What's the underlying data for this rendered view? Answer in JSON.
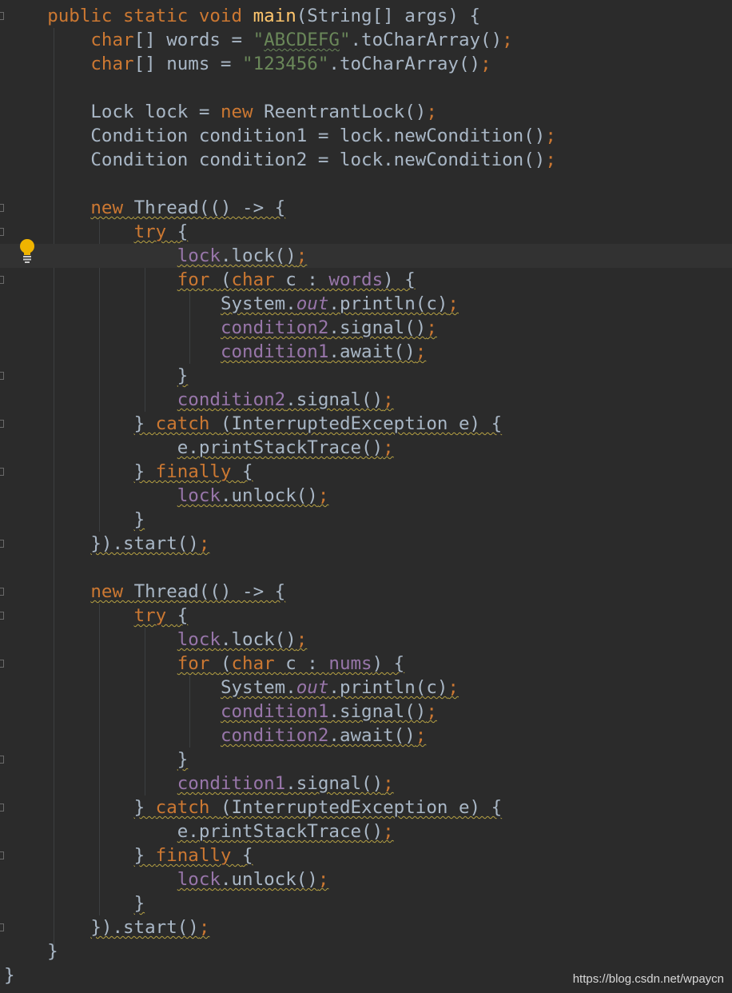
{
  "editor": {
    "colors": {
      "background": "#2b2b2b",
      "current_line": "#323232",
      "keyword": "#cc7832",
      "method_decl": "#ffc66d",
      "string": "#6a8759",
      "field": "#9876aa",
      "plain": "#a9b7c6",
      "warning_underline": "#b7a243"
    },
    "current_line_index": 10,
    "lines": [
      [
        {
          "t": "    "
        },
        {
          "t": "public static void ",
          "c": "kw"
        },
        {
          "t": "main",
          "c": "fn"
        },
        {
          "t": "(String[] args) {"
        }
      ],
      [
        {
          "t": "        "
        },
        {
          "t": "char",
          "c": "kw"
        },
        {
          "t": "[] words = "
        },
        {
          "t": "\"",
          "c": "str"
        },
        {
          "t": "ABCDEFG",
          "c": "str",
          "u": "typo"
        },
        {
          "t": "\"",
          "c": "str"
        },
        {
          "t": ".toCharArray()"
        },
        {
          "t": ";",
          "c": "kw"
        }
      ],
      [
        {
          "t": "        "
        },
        {
          "t": "char",
          "c": "kw"
        },
        {
          "t": "[] nums = "
        },
        {
          "t": "\"123456\"",
          "c": "str"
        },
        {
          "t": ".toCharArray()"
        },
        {
          "t": ";",
          "c": "kw"
        }
      ],
      [
        {
          "t": ""
        }
      ],
      [
        {
          "t": "        Lock lock = "
        },
        {
          "t": "new ",
          "c": "kw"
        },
        {
          "t": "ReentrantLock()"
        },
        {
          "t": ";",
          "c": "kw"
        }
      ],
      [
        {
          "t": "        Condition condition1 = lock.newCondition()"
        },
        {
          "t": ";",
          "c": "kw"
        }
      ],
      [
        {
          "t": "        Condition condition2 = lock.newCondition()"
        },
        {
          "t": ";",
          "c": "kw"
        }
      ],
      [
        {
          "t": ""
        }
      ],
      [
        {
          "t": "        "
        },
        {
          "t": "new ",
          "c": "kw",
          "u": "warn"
        },
        {
          "t": "Thread(() -> {",
          "u": "warn"
        }
      ],
      [
        {
          "t": "            "
        },
        {
          "t": "try ",
          "c": "kw",
          "u": "warn"
        },
        {
          "t": "{",
          "u": "warn"
        }
      ],
      [
        {
          "t": "                "
        },
        {
          "t": "lock",
          "c": "fld",
          "u": "warn"
        },
        {
          "t": ".lock()",
          "u": "warn"
        },
        {
          "t": ";",
          "c": "kw",
          "u": "warn"
        }
      ],
      [
        {
          "t": "                "
        },
        {
          "t": "for ",
          "c": "kw",
          "u": "warn"
        },
        {
          "t": "(",
          "u": "warn"
        },
        {
          "t": "char ",
          "c": "kw",
          "u": "warn"
        },
        {
          "t": "c : ",
          "u": "warn"
        },
        {
          "t": "words",
          "c": "fld",
          "u": "warn"
        },
        {
          "t": ") {",
          "u": "warn"
        }
      ],
      [
        {
          "t": "                    "
        },
        {
          "t": "System.",
          "u": "warn"
        },
        {
          "t": "out",
          "c": "fld-it",
          "u": "warn"
        },
        {
          "t": ".println(c)",
          "u": "warn"
        },
        {
          "t": ";",
          "c": "kw",
          "u": "warn"
        }
      ],
      [
        {
          "t": "                    "
        },
        {
          "t": "condition2",
          "c": "fld",
          "u": "warn"
        },
        {
          "t": ".signal()",
          "u": "warn"
        },
        {
          "t": ";",
          "c": "kw",
          "u": "warn"
        }
      ],
      [
        {
          "t": "                    "
        },
        {
          "t": "condition1",
          "c": "fld",
          "u": "warn"
        },
        {
          "t": ".await()",
          "u": "warn"
        },
        {
          "t": ";",
          "c": "kw",
          "u": "warn"
        }
      ],
      [
        {
          "t": "                "
        },
        {
          "t": "}",
          "u": "warn"
        }
      ],
      [
        {
          "t": "                "
        },
        {
          "t": "condition2",
          "c": "fld",
          "u": "warn"
        },
        {
          "t": ".signal()",
          "u": "warn"
        },
        {
          "t": ";",
          "c": "kw",
          "u": "warn"
        }
      ],
      [
        {
          "t": "            "
        },
        {
          "t": "} ",
          "u": "warn"
        },
        {
          "t": "catch ",
          "c": "kw",
          "u": "warn"
        },
        {
          "t": "(InterruptedException e) {",
          "u": "warn"
        }
      ],
      [
        {
          "t": "                "
        },
        {
          "t": "e.printStackTrace()",
          "u": "warn"
        },
        {
          "t": ";",
          "c": "kw",
          "u": "warn"
        }
      ],
      [
        {
          "t": "            "
        },
        {
          "t": "} ",
          "u": "warn"
        },
        {
          "t": "finally ",
          "c": "kw",
          "u": "warn"
        },
        {
          "t": "{",
          "u": "warn"
        }
      ],
      [
        {
          "t": "                "
        },
        {
          "t": "lock",
          "c": "fld",
          "u": "warn"
        },
        {
          "t": ".unlock()",
          "u": "warn"
        },
        {
          "t": ";",
          "c": "kw",
          "u": "warn"
        }
      ],
      [
        {
          "t": "            "
        },
        {
          "t": "}",
          "u": "warn"
        }
      ],
      [
        {
          "t": "        "
        },
        {
          "t": "}).start()",
          "u": "warn"
        },
        {
          "t": ";",
          "c": "kw",
          "u": "warn"
        }
      ],
      [
        {
          "t": ""
        }
      ],
      [
        {
          "t": "        "
        },
        {
          "t": "new ",
          "c": "kw",
          "u": "warn"
        },
        {
          "t": "Thread(() -> {",
          "u": "warn"
        }
      ],
      [
        {
          "t": "            "
        },
        {
          "t": "try ",
          "c": "kw",
          "u": "warn"
        },
        {
          "t": "{",
          "u": "warn"
        }
      ],
      [
        {
          "t": "                "
        },
        {
          "t": "lock",
          "c": "fld",
          "u": "warn"
        },
        {
          "t": ".lock()",
          "u": "warn"
        },
        {
          "t": ";",
          "c": "kw",
          "u": "warn"
        }
      ],
      [
        {
          "t": "                "
        },
        {
          "t": "for ",
          "c": "kw",
          "u": "warn"
        },
        {
          "t": "(",
          "u": "warn"
        },
        {
          "t": "char ",
          "c": "kw",
          "u": "warn"
        },
        {
          "t": "c : ",
          "u": "warn"
        },
        {
          "t": "nums",
          "c": "fld",
          "u": "warn"
        },
        {
          "t": ") {",
          "u": "warn"
        }
      ],
      [
        {
          "t": "                    "
        },
        {
          "t": "System.",
          "u": "warn"
        },
        {
          "t": "out",
          "c": "fld-it",
          "u": "warn"
        },
        {
          "t": ".println(c)",
          "u": "warn"
        },
        {
          "t": ";",
          "c": "kw",
          "u": "warn"
        }
      ],
      [
        {
          "t": "                    "
        },
        {
          "t": "condition1",
          "c": "fld",
          "u": "warn"
        },
        {
          "t": ".signal()",
          "u": "warn"
        },
        {
          "t": ";",
          "c": "kw",
          "u": "warn"
        }
      ],
      [
        {
          "t": "                    "
        },
        {
          "t": "condition2",
          "c": "fld",
          "u": "warn"
        },
        {
          "t": ".await()",
          "u": "warn"
        },
        {
          "t": ";",
          "c": "kw",
          "u": "warn"
        }
      ],
      [
        {
          "t": "                "
        },
        {
          "t": "}",
          "u": "warn"
        }
      ],
      [
        {
          "t": "                "
        },
        {
          "t": "condition1",
          "c": "fld",
          "u": "warn"
        },
        {
          "t": ".signal()",
          "u": "warn"
        },
        {
          "t": ";",
          "c": "kw",
          "u": "warn"
        }
      ],
      [
        {
          "t": "            "
        },
        {
          "t": "} ",
          "u": "warn"
        },
        {
          "t": "catch ",
          "c": "kw",
          "u": "warn"
        },
        {
          "t": "(InterruptedException e) {",
          "u": "warn"
        }
      ],
      [
        {
          "t": "                "
        },
        {
          "t": "e.printStackTrace()",
          "u": "warn"
        },
        {
          "t": ";",
          "c": "kw",
          "u": "warn"
        }
      ],
      [
        {
          "t": "            "
        },
        {
          "t": "} ",
          "u": "warn"
        },
        {
          "t": "finally ",
          "c": "kw",
          "u": "warn"
        },
        {
          "t": "{",
          "u": "warn"
        }
      ],
      [
        {
          "t": "                "
        },
        {
          "t": "lock",
          "c": "fld",
          "u": "warn"
        },
        {
          "t": ".unlock()",
          "u": "warn"
        },
        {
          "t": ";",
          "c": "kw",
          "u": "warn"
        }
      ],
      [
        {
          "t": "            "
        },
        {
          "t": "}",
          "u": "warn"
        }
      ],
      [
        {
          "t": "        "
        },
        {
          "t": "}).start()",
          "u": "warn"
        },
        {
          "t": ";",
          "c": "kw",
          "u": "warn"
        }
      ],
      [
        {
          "t": "    }"
        }
      ],
      [
        {
          "t": "}"
        }
      ]
    ]
  },
  "gutter": {
    "intention_icon": "lightbulb-icon"
  },
  "watermark": {
    "text": "https://blog.csdn.net/wpaycn"
  }
}
